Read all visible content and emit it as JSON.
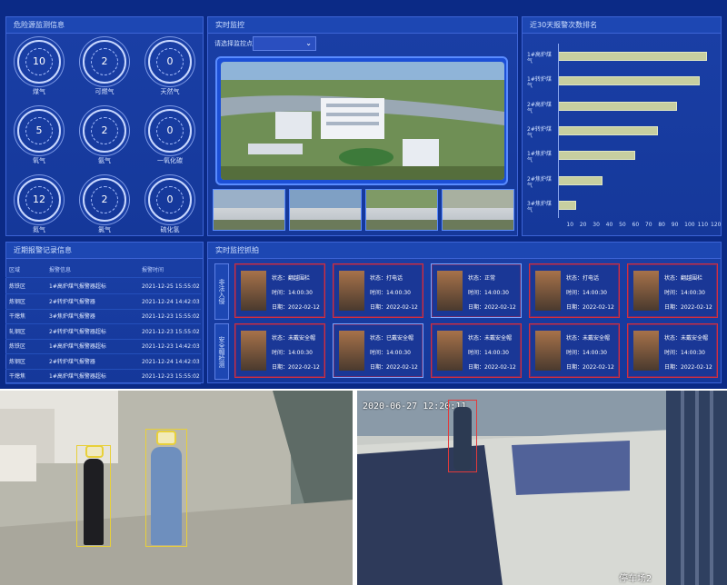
{
  "gauges": {
    "title": "危险源监测信息",
    "items": [
      {
        "value": "10",
        "label": "煤气"
      },
      {
        "value": "2",
        "label": "可燃气"
      },
      {
        "value": "0",
        "label": "天然气"
      },
      {
        "value": "5",
        "label": "氧气"
      },
      {
        "value": "2",
        "label": "氨气"
      },
      {
        "value": "0",
        "label": "一氧化碳"
      },
      {
        "value": "12",
        "label": "氮气"
      },
      {
        "value": "2",
        "label": "氯气"
      },
      {
        "value": "0",
        "label": "硫化氢"
      }
    ]
  },
  "video": {
    "title": "实时监控",
    "select_label": "请选择监控点",
    "select_value": "",
    "thumbs": 4
  },
  "chart_panel": {
    "title": "近30天报警次数排名"
  },
  "chart_data": {
    "type": "bar",
    "orientation": "horizontal",
    "categories": [
      "1#高炉煤气",
      "1#转炉煤气",
      "2#高炉煤气",
      "2#转炉煤气",
      "1#焦炉煤气",
      "2#焦炉煤气",
      "3#焦炉煤气"
    ],
    "values": [
      114,
      108,
      91,
      76,
      59,
      34,
      14
    ],
    "xlim": [
      0,
      120
    ],
    "xticks": [
      "10",
      "20",
      "30",
      "40",
      "50",
      "60",
      "70",
      "80",
      "90",
      "100",
      "110",
      "120"
    ],
    "bar_color": "#c7cfa0"
  },
  "table": {
    "title": "近期报警记录信息",
    "headers": [
      "区域",
      "报警信息",
      "报警时间"
    ],
    "rows": [
      [
        "炼铁区",
        "1#高炉煤气报警器超标",
        "2021-12-25 15:55:02"
      ],
      [
        "炼钢区",
        "2#转炉煤气报警器",
        "2021-12-24 14:42:03"
      ],
      [
        "干熄焦",
        "3#焦炉煤气报警器",
        "2021-12-23 15:55:02"
      ],
      [
        "轧钢区",
        "2#转炉煤气报警器超标",
        "2021-12-23 15:55:02"
      ],
      [
        "炼铁区",
        "1#高炉煤气报警器超标",
        "2021-12-23 14:42:03"
      ],
      [
        "炼钢区",
        "2#转炉煤气报警器",
        "2021-12-24 14:42:03"
      ],
      [
        "干熄焦",
        "1#高炉煤气报警器超标",
        "2021-12-23 15:55:02"
      ]
    ]
  },
  "alerts": {
    "title": "实时监控抓拍",
    "row_labels": [
      "非法入侵",
      "安全帽检测"
    ],
    "cards": [
      {
        "status": "状态：翻越围栏",
        "time": "时间：14:00:30",
        "date": "日期：2022-02-12",
        "alt": false
      },
      {
        "status": "状态：打电话",
        "time": "时间：14:00:30",
        "date": "日期：2022-02-12",
        "alt": false
      },
      {
        "status": "状态：正常",
        "time": "时间：14:00:30",
        "date": "日期：2022-02-12",
        "alt": true
      },
      {
        "status": "状态：打电话",
        "time": "时间：14:00:30",
        "date": "日期：2022-02-12",
        "alt": false
      },
      {
        "status": "状态：翻越围栏",
        "time": "时间：14:00:30",
        "date": "日期：2022-02-12",
        "alt": false
      },
      {
        "status": "状态：未戴安全帽",
        "time": "时间：14:00:30",
        "date": "日期：2022-02-12",
        "alt": false
      },
      {
        "status": "状态：已戴安全帽",
        "time": "时间：14:00:30",
        "date": "日期：2022-02-12",
        "alt": true
      },
      {
        "status": "状态：未戴安全帽",
        "time": "时间：14:00:30",
        "date": "日期：2022-02-12",
        "alt": false
      },
      {
        "status": "状态：未戴安全帽",
        "time": "时间：14:00:30",
        "date": "日期：2022-02-12",
        "alt": false
      },
      {
        "status": "状态：未戴安全帽",
        "time": "时间：14:00:30",
        "date": "日期：2022-02-12",
        "alt": false
      }
    ]
  },
  "camera_right": {
    "timestamp": "2020-06-27 12:20:11",
    "channel": "停车场2"
  }
}
